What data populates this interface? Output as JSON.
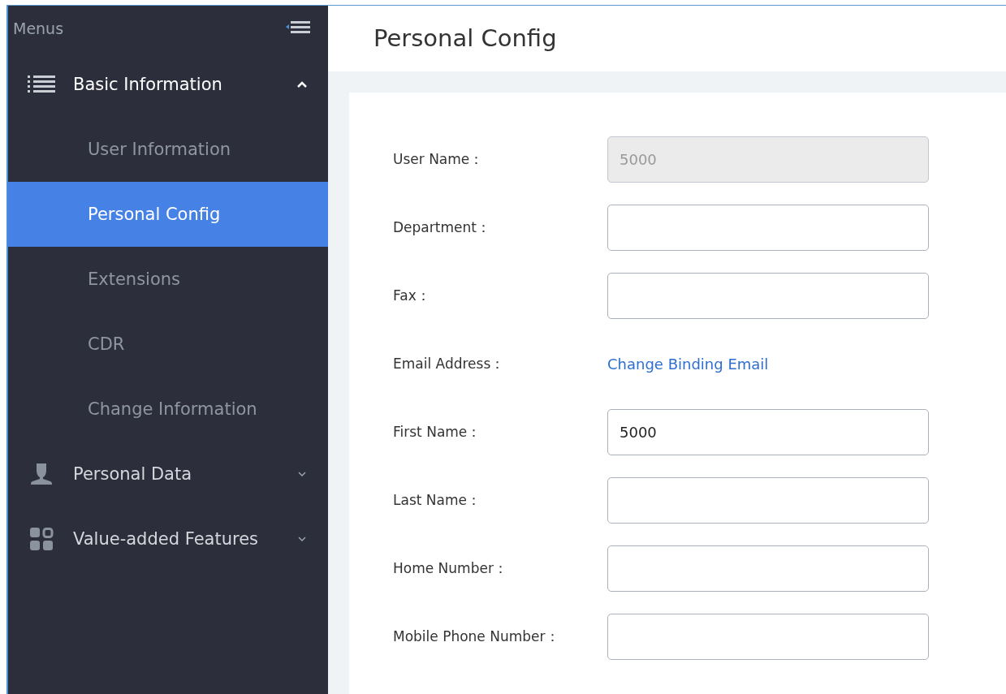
{
  "sidebar": {
    "title": "Menus",
    "items": [
      {
        "label": "Basic Information",
        "expanded": true,
        "children": [
          {
            "label": "User Information",
            "selected": false
          },
          {
            "label": "Personal Config",
            "selected": true
          },
          {
            "label": "Extensions",
            "selected": false
          },
          {
            "label": "CDR",
            "selected": false
          },
          {
            "label": "Change Information",
            "selected": false
          }
        ]
      },
      {
        "label": "Personal Data",
        "expanded": false
      },
      {
        "label": "Value-added Features",
        "expanded": false
      }
    ]
  },
  "page": {
    "title": "Personal Config"
  },
  "form": [
    {
      "label": "User Name：",
      "kind": "input",
      "value": "5000",
      "disabled": true
    },
    {
      "label": "Department：",
      "kind": "input",
      "disabled": false
    },
    {
      "label": "Fax：",
      "kind": "input",
      "disabled": false
    },
    {
      "label": "Email Address：",
      "kind": "link",
      "link": "Change Binding Email"
    },
    {
      "label": "First Name：",
      "kind": "input",
      "value": "5000",
      "disabled": false
    },
    {
      "label": "Last Name：",
      "kind": "input",
      "disabled": false
    },
    {
      "label": "Home Number：",
      "kind": "input",
      "disabled": false
    },
    {
      "label": "Mobile Phone Number：",
      "kind": "input",
      "disabled": false
    }
  ]
}
